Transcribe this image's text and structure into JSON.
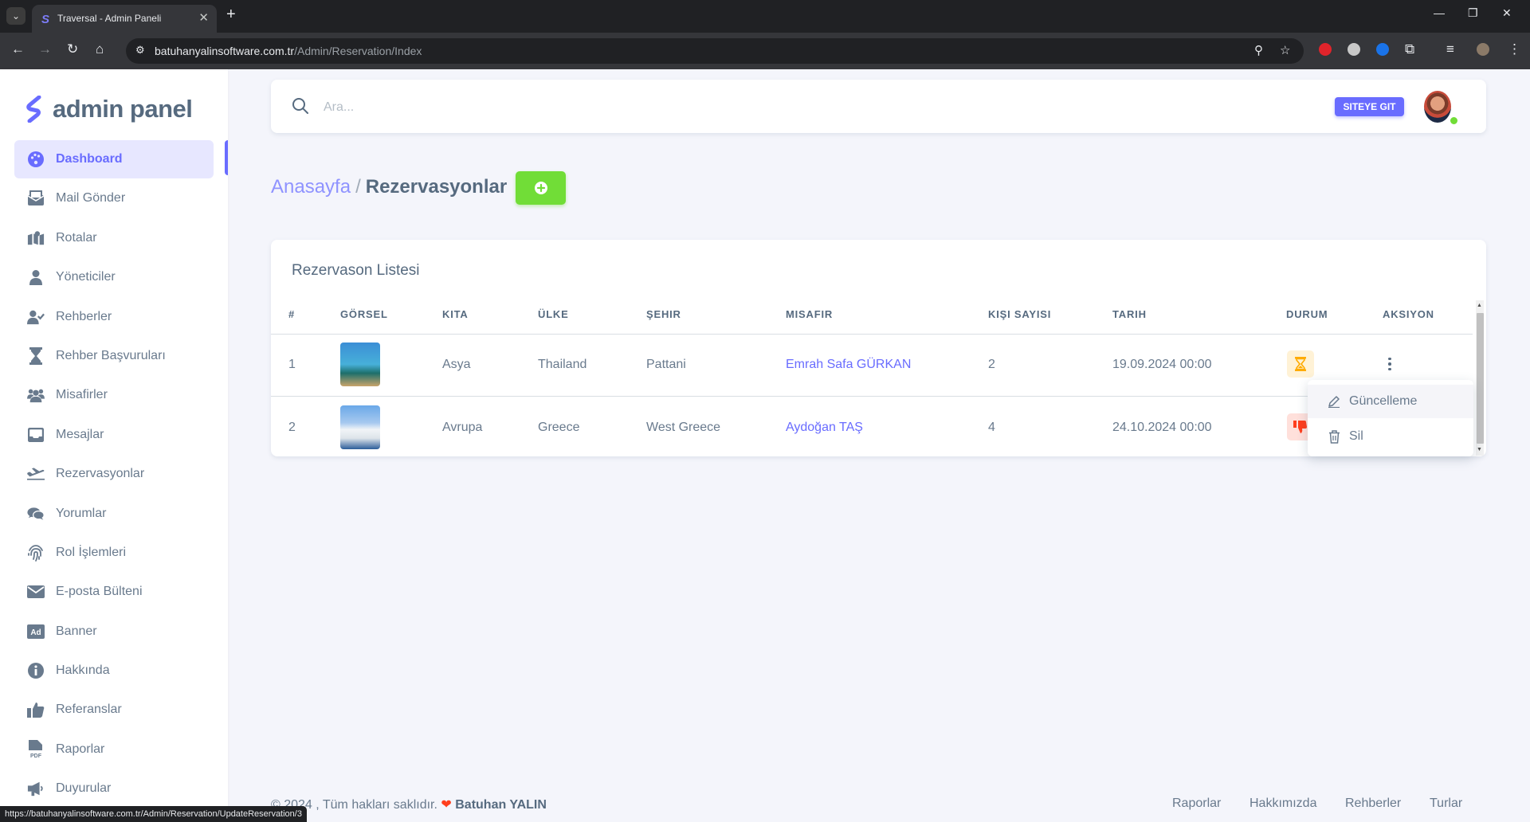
{
  "browser": {
    "tab_title": "Traversal - Admin Paneli",
    "url_host": "batuhanyalinsoftware.com.tr",
    "url_path": "/Admin/Reservation/Index",
    "status_url": "https://batuhanyalinsoftware.com.tr/Admin/Reservation/UpdateReservation/3"
  },
  "brand": {
    "name": "admin panel",
    "color": "#696cff"
  },
  "sidebar": {
    "items": [
      {
        "label": "Dashboard",
        "icon": "palette-icon",
        "active": true
      },
      {
        "label": "Mail Gönder",
        "icon": "mail-send-icon"
      },
      {
        "label": "Rotalar",
        "icon": "map-icon"
      },
      {
        "label": "Yöneticiler",
        "icon": "user-icon"
      },
      {
        "label": "Rehberler",
        "icon": "user-check-icon"
      },
      {
        "label": "Rehber Başvuruları",
        "icon": "hourglass-icon"
      },
      {
        "label": "Misafirler",
        "icon": "users-icon"
      },
      {
        "label": "Mesajlar",
        "icon": "inbox-icon"
      },
      {
        "label": "Rezervasyonlar",
        "icon": "plane-icon"
      },
      {
        "label": "Yorumlar",
        "icon": "comments-icon"
      },
      {
        "label": "Rol İşlemleri",
        "icon": "fingerprint-icon"
      },
      {
        "label": "E-posta Bülteni",
        "icon": "envelope-icon"
      },
      {
        "label": "Banner",
        "icon": "ad-icon"
      },
      {
        "label": "Hakkında",
        "icon": "info-icon"
      },
      {
        "label": "Referanslar",
        "icon": "thumbs-up-icon"
      },
      {
        "label": "Raporlar",
        "icon": "pdf-icon"
      },
      {
        "label": "Duyurular",
        "icon": "megaphone-icon"
      }
    ]
  },
  "topnav": {
    "search_placeholder": "Ara...",
    "site_button": "SITEYE GIT"
  },
  "breadcrumb": {
    "home": "Anasayfa",
    "separator": "/",
    "current": "Rezervasyonlar"
  },
  "card": {
    "title": "Rezervason Listesi",
    "headers": [
      "#",
      "GÖRSEL",
      "KITA",
      "ÜLKE",
      "ŞEHIR",
      "MISAFIR",
      "KIŞI SAYISI",
      "TARIH",
      "DURUM",
      "AKSIYON"
    ],
    "rows": [
      {
        "no": "1",
        "continent": "Asya",
        "country": "Thailand",
        "city": "Pattani",
        "guest": "Emrah Safa GÜRKAN",
        "people": "2",
        "date": "19.09.2024 00:00",
        "status": "pending"
      },
      {
        "no": "2",
        "continent": "Avrupa",
        "country": "Greece",
        "city": "West Greece",
        "guest": "Aydoğan TAŞ",
        "people": "4",
        "date": "24.10.2024 00:00",
        "status": "rejected"
      }
    ]
  },
  "dropdown": {
    "update": "Güncelleme",
    "delete": "Sil"
  },
  "footer": {
    "copyright": "© 2024 , Tüm hakları saklıdır.",
    "author": "Batuhan YALIN",
    "links": [
      "Raporlar",
      "Hakkımızda",
      "Rehberler",
      "Turlar"
    ]
  },
  "colors": {
    "primary": "#696cff",
    "success": "#71dd37",
    "warning": "#ffab00",
    "danger": "#ff3e1d"
  }
}
